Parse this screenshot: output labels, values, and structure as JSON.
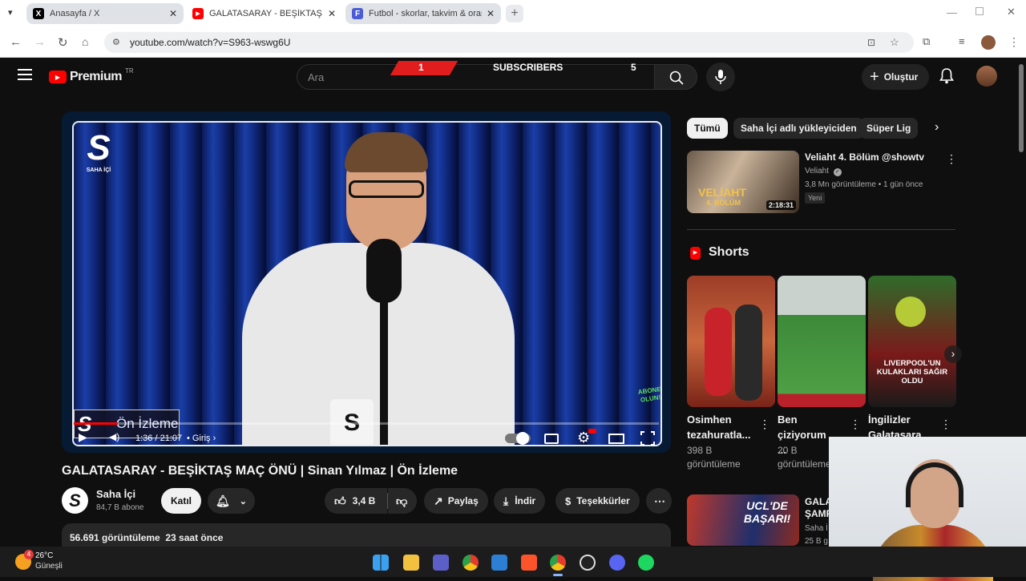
{
  "browser": {
    "tabs": [
      {
        "label": "Anasayfa / X",
        "icon": "x-logo-icon"
      },
      {
        "label": "GALATASARAY - BEŞİKTAŞ MAÇ",
        "icon": "youtube-icon"
      },
      {
        "label": "Futbol - skorlar, takvim & oran",
        "icon": "flashscore-icon"
      }
    ],
    "url": "youtube.com/watch?v=S963-wswg6U"
  },
  "yt": {
    "logo_text": "Premium",
    "logo_sup": "TR",
    "search_placeholder": "Ara",
    "create_label": "Oluştur",
    "overlay": {
      "left": "1",
      "center": "SUBSCRIBERS",
      "right": "5"
    }
  },
  "player": {
    "channel_logo_text": "S",
    "channel_logo_sub": "SAHA İÇİ",
    "lower_third": "Ön İzleme",
    "time": "1:36 / 21:07",
    "chapter": "• Giriş",
    "progress": 0.076,
    "subscribe_badge": "ABONE OLUN!"
  },
  "video": {
    "title": "GALATASARAY - BEŞİKTAŞ MAÇ ÖNÜ | Sinan Yılmaz | Ön İzleme",
    "channel": "Saha İçi",
    "subs": "84,7 B abone",
    "join": "Katıl",
    "likes": "3,4 B",
    "share": "Paylaş",
    "download": "İndir",
    "thanks": "Teşekkürler",
    "views_line": "56.691 görüntüleme  23 saat önce"
  },
  "sidebar": {
    "chips": [
      "Tümü",
      "Saha İçi adlı yükleyiciden",
      "Süper Lig"
    ],
    "rec": {
      "title": "Veliaht 4. Bölüm @showtv",
      "channel": "Veliaht",
      "meta": "3,8 Mn görüntüleme • 1 gün önce",
      "badge": "Yeni",
      "duration": "2:18:31",
      "thumb_text": "VELİAHT",
      "thumb_sub": "4. BÖLÜM"
    },
    "shorts_label": "Shorts",
    "shorts": [
      {
        "title": "Osimhen tezahuratla...",
        "views": "398 B",
        "unit": "görüntüleme"
      },
      {
        "title": "Ben çiziyorum ...",
        "views": "20 B",
        "unit": "görüntüleme"
      },
      {
        "title": "İngilizler Galatasara...",
        "views": "",
        "unit": ""
      }
    ],
    "short3_caption": "LIVERPOOL'UN KULAKLARI SAĞIR OLDU",
    "next": {
      "thumb_text": "UCL'DE BAŞARI!",
      "title": "GALA ŞAMP",
      "channel": "Saha İ",
      "meta": "25 B g"
    }
  },
  "taskbar": {
    "temp": "26°C",
    "weather": "Güneşli",
    "badge": "4"
  },
  "colors": {
    "yt_red": "#ff0000",
    "bg": "#0f0f0f",
    "chip": "#272727"
  }
}
